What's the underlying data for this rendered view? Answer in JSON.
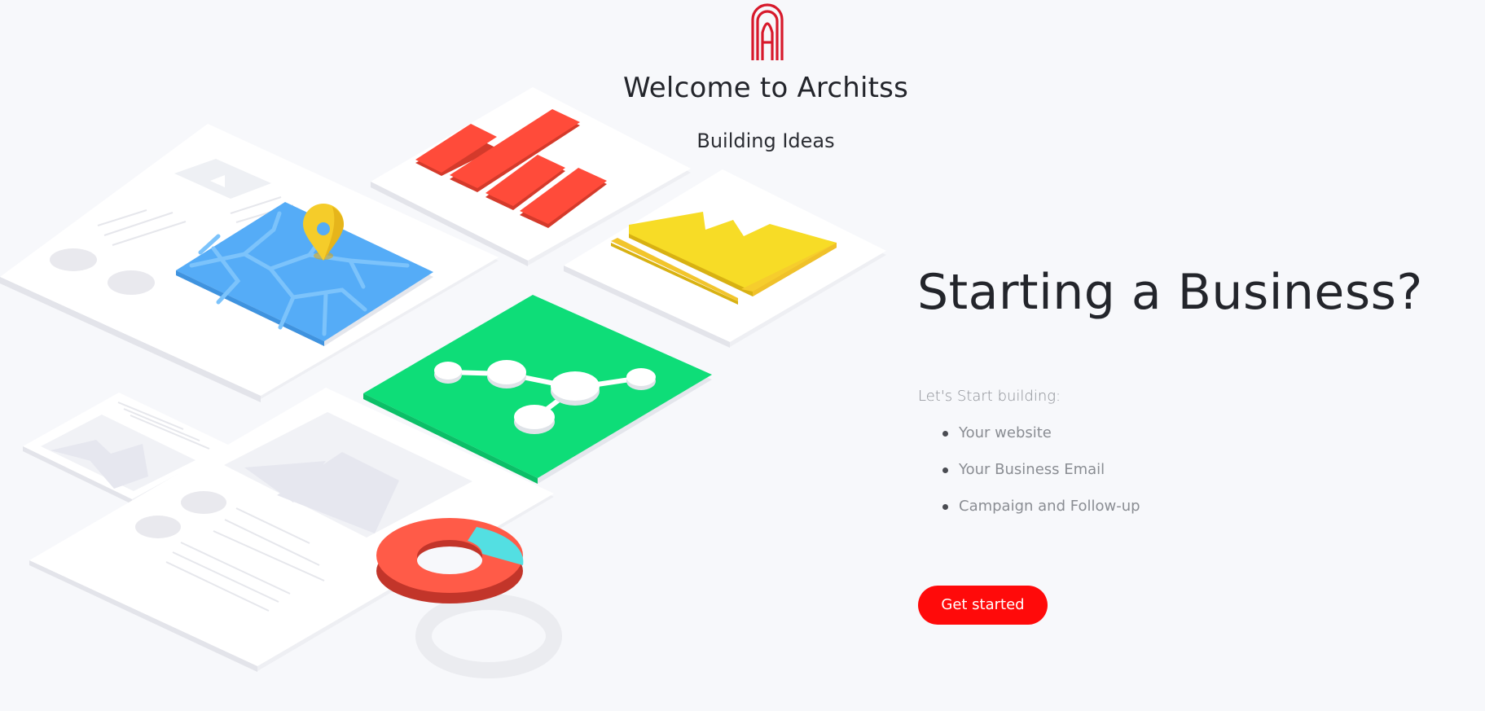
{
  "header": {
    "logo_icon": "arch-a-monogram-icon",
    "title": "Welcome to Architss",
    "subtitle": "Building Ideas"
  },
  "hero": {
    "illustration": "isometric-business-dashboard-illustration",
    "headline": "Starting a Business?",
    "intro": "Let's Start building:",
    "features": [
      "Your website",
      "Your Business Email",
      "Campaign and Follow-up"
    ],
    "cta_label": "Get started"
  },
  "colors": {
    "background": "#f7f8fb",
    "accent": "#ff0a0a",
    "logo": "#d7192b",
    "map_blue": "#55acf7",
    "graph_green": "#0edd78",
    "chart_red": "#ff4b3a",
    "crown_yellow": "#f7d92a",
    "donut_cyan": "#50dfe3"
  }
}
